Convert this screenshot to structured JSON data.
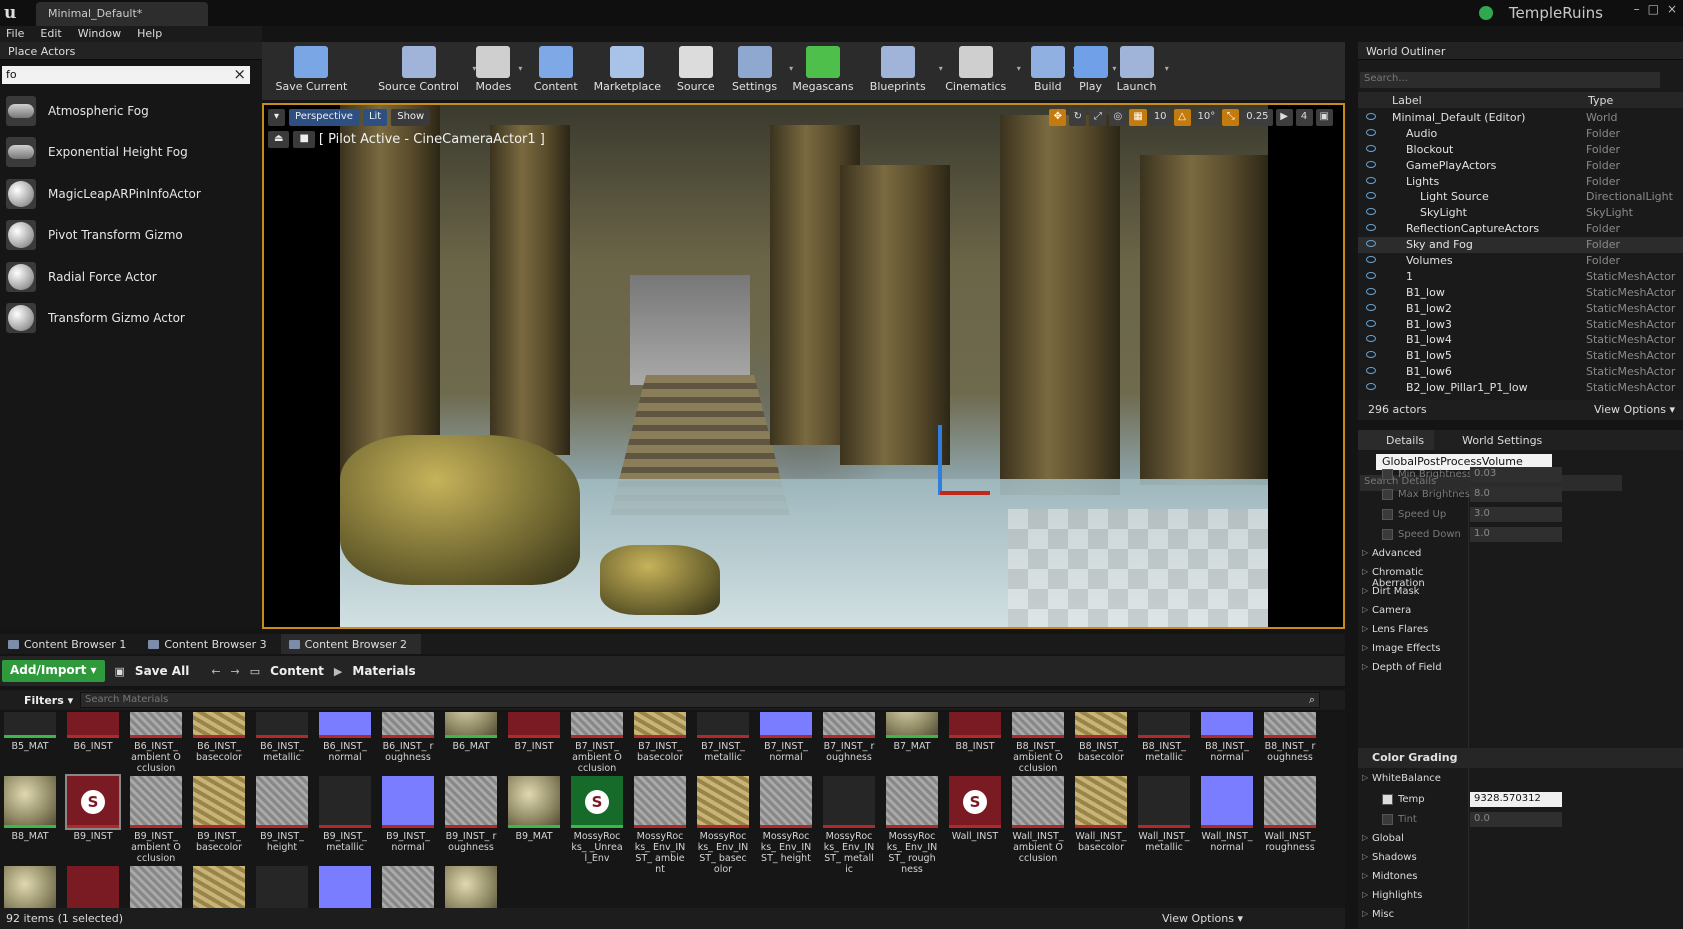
{
  "window": {
    "doc_tab": "Minimal_Default*",
    "project": "TempleRuins",
    "controls": [
      "–",
      "□",
      "×"
    ]
  },
  "menu": [
    "File",
    "Edit",
    "Window",
    "Help"
  ],
  "place_actors": {
    "tab": "Place Actors",
    "search_value": "fo",
    "items": [
      {
        "label": "Atmospheric Fog",
        "icon": "cloud-icon"
      },
      {
        "label": "Exponential Height Fog",
        "icon": "cloud-icon"
      },
      {
        "label": "MagicLeapARPinInfoActor",
        "icon": "sphere-icon"
      },
      {
        "label": "Pivot Transform Gizmo",
        "icon": "sphere-icon"
      },
      {
        "label": "Radial Force Actor",
        "icon": "radial-icon"
      },
      {
        "label": "Transform Gizmo Actor",
        "icon": "sphere-icon"
      }
    ]
  },
  "toolbar": {
    "buttons": [
      {
        "label": "Save Current",
        "icon": "save-icon",
        "color": "#7aa6e6"
      },
      {
        "label": "Source Control",
        "icon": "source-control-icon",
        "color": "#9fb4d8"
      },
      {
        "label": "Modes",
        "icon": "modes-icon",
        "color": "#cfcfcf"
      },
      {
        "label": "Content",
        "icon": "content-icon",
        "color": "#7ea9e6"
      },
      {
        "label": "Marketplace",
        "icon": "marketplace-icon",
        "color": "#a9c3e8"
      },
      {
        "label": "Source",
        "icon": "source-icon",
        "color": "#dcdcdc"
      },
      {
        "label": "Settings",
        "icon": "settings-icon",
        "color": "#8fa8d0"
      },
      {
        "label": "Megascans",
        "icon": "megascans-icon",
        "color": "#4fbf4b"
      },
      {
        "label": "Blueprints",
        "icon": "blueprints-icon",
        "color": "#9fb4d8"
      },
      {
        "label": "Cinematics",
        "icon": "cinematics-icon",
        "color": "#cfcfcf"
      },
      {
        "label": "Build",
        "icon": "build-icon",
        "color": "#8fb0e0"
      },
      {
        "label": "Play",
        "icon": "play-icon",
        "color": "#6fa0e8"
      },
      {
        "label": "Launch",
        "icon": "launch-icon",
        "color": "#9fb4d8"
      }
    ]
  },
  "viewport": {
    "perspective": "Perspective",
    "lit": "Lit",
    "show": "Show",
    "pilot": "[ Pilot Active - CineCameraActor1 ]",
    "grid": "10",
    "rotation": "10°",
    "scale": "0.25",
    "camera_speed": "4"
  },
  "content_browser": {
    "tabs": [
      "Content Browser 1",
      "Content Browser 3",
      "Content Browser 2"
    ],
    "add_import": "Add/Import ▾",
    "save_all": "Save All",
    "path": [
      "Content",
      "Materials"
    ],
    "filters": "Filters ▾",
    "search_placeholder": "Search Materials",
    "row1": [
      {
        "name": "B5_MAT",
        "tex": "t-dark",
        "kind": "mat"
      },
      {
        "name": "B6_INST",
        "tex": "t-red",
        "kind": "inst"
      },
      {
        "name": "B6_INST_ ambient Occlusion",
        "tex": "t-gray",
        "kind": "inst"
      },
      {
        "name": "B6_INST_ basecolor",
        "tex": "t-gold",
        "kind": "inst"
      },
      {
        "name": "B6_INST_ metallic",
        "tex": "t-dark",
        "kind": "inst"
      },
      {
        "name": "B6_INST_ normal",
        "tex": "t-blue",
        "kind": "inst"
      },
      {
        "name": "B6_INST_ roughness",
        "tex": "t-gray",
        "kind": "inst"
      },
      {
        "name": "B6_MAT",
        "tex": "t-rock",
        "kind": "mat"
      },
      {
        "name": "B7_INST",
        "tex": "t-red",
        "kind": "inst"
      },
      {
        "name": "B7_INST_ ambient Occlusion",
        "tex": "t-gray",
        "kind": "inst"
      },
      {
        "name": "B7_INST_ basecolor",
        "tex": "t-gold",
        "kind": "inst"
      },
      {
        "name": "B7_INST_ metallic",
        "tex": "t-dark",
        "kind": "inst"
      },
      {
        "name": "B7_INST_ normal",
        "tex": "t-blue",
        "kind": "inst"
      },
      {
        "name": "B7_INST_ roughness",
        "tex": "t-gray",
        "kind": "inst"
      },
      {
        "name": "B7_MAT",
        "tex": "t-rock",
        "kind": "mat"
      },
      {
        "name": "B8_INST",
        "tex": "t-red",
        "kind": "inst"
      },
      {
        "name": "B8_INST_ ambient Occlusion",
        "tex": "t-gray",
        "kind": "inst"
      },
      {
        "name": "B8_INST_ basecolor",
        "tex": "t-gold",
        "kind": "inst"
      },
      {
        "name": "B8_INST_ metallic",
        "tex": "t-dark",
        "kind": "inst"
      },
      {
        "name": "B8_INST_ normal",
        "tex": "t-blue",
        "kind": "inst"
      },
      {
        "name": "B8_INST_ roughness",
        "tex": "t-gray",
        "kind": "inst"
      }
    ],
    "row2": [
      {
        "name": "B8_MAT",
        "tex": "t-rock",
        "kind": "mat",
        "logo": ""
      },
      {
        "name": "B9_INST",
        "tex": "t-red",
        "kind": "inst",
        "logo": "S",
        "selected": true
      },
      {
        "name": "B9_INST_ ambient Occlusion",
        "tex": "t-gray",
        "kind": "inst",
        "logo": ""
      },
      {
        "name": "B9_INST_ basecolor",
        "tex": "t-gold",
        "kind": "inst",
        "logo": ""
      },
      {
        "name": "B9_INST_ height",
        "tex": "t-gray",
        "kind": "inst",
        "logo": ""
      },
      {
        "name": "B9_INST_ metallic",
        "tex": "t-dark",
        "kind": "inst",
        "logo": ""
      },
      {
        "name": "B9_INST_ normal",
        "tex": "t-blue",
        "kind": "inst",
        "logo": ""
      },
      {
        "name": "B9_INST_ roughness",
        "tex": "t-gray",
        "kind": "inst",
        "logo": ""
      },
      {
        "name": "B9_MAT",
        "tex": "t-rock",
        "kind": "mat",
        "logo": ""
      },
      {
        "name": "MossyRocks_ _Unreal_Env",
        "tex": "t-green",
        "kind": "mat",
        "logo": "S"
      },
      {
        "name": "MossyRocks_ Env_INST_ ambient",
        "tex": "t-gray",
        "kind": "inst",
        "logo": ""
      },
      {
        "name": "MossyRocks_ Env_INST_ basecolor",
        "tex": "t-gold",
        "kind": "inst",
        "logo": ""
      },
      {
        "name": "MossyRocks_ Env_INST_ height",
        "tex": "t-gray",
        "kind": "inst",
        "logo": ""
      },
      {
        "name": "MossyRocks_ Env_INST_ metallic",
        "tex": "t-dark",
        "kind": "inst",
        "logo": ""
      },
      {
        "name": "MossyRocks_ Env_INST_ roughness",
        "tex": "t-gray",
        "kind": "inst",
        "logo": ""
      },
      {
        "name": "Wall_INST",
        "tex": "t-red",
        "kind": "inst",
        "logo": "S"
      },
      {
        "name": "Wall_INST_ ambient Occlusion",
        "tex": "t-gray",
        "kind": "inst",
        "logo": ""
      },
      {
        "name": "Wall_INST_ basecolor",
        "tex": "t-gold",
        "kind": "inst",
        "logo": ""
      },
      {
        "name": "Wall_INST_ metallic",
        "tex": "t-dark",
        "kind": "inst",
        "logo": ""
      },
      {
        "name": "Wall_INST_ normal",
        "tex": "t-blue",
        "kind": "inst",
        "logo": ""
      },
      {
        "name": "Wall_INST_ roughness",
        "tex": "t-gray",
        "kind": "inst",
        "logo": ""
      }
    ],
    "status": "92 items (1 selected)",
    "view_options": "View Options ▾"
  },
  "outliner": {
    "tab": "World Outliner",
    "search_placeholder": "Search...",
    "col_label": "Label",
    "col_type": "Type",
    "rows": [
      {
        "label": "Minimal_Default (Editor)",
        "type": "World",
        "indent": 0
      },
      {
        "label": "Audio",
        "type": "Folder",
        "indent": 1
      },
      {
        "label": "Blockout",
        "type": "Folder",
        "indent": 1
      },
      {
        "label": "GamePlayActors",
        "type": "Folder",
        "indent": 1
      },
      {
        "label": "Lights",
        "type": "Folder",
        "indent": 1
      },
      {
        "label": "Light Source",
        "type": "DirectionalLight",
        "indent": 2
      },
      {
        "label": "SkyLight",
        "type": "SkyLight",
        "indent": 2
      },
      {
        "label": "ReflectionCaptureActors",
        "type": "Folder",
        "indent": 1
      },
      {
        "label": "Sky and Fog",
        "type": "Folder",
        "indent": 1,
        "hl": true
      },
      {
        "label": "Volumes",
        "type": "Folder",
        "indent": 1
      },
      {
        "label": "1",
        "type": "StaticMeshActor",
        "indent": 1
      },
      {
        "label": "B1_low",
        "type": "StaticMeshActor",
        "indent": 1
      },
      {
        "label": "B1_low2",
        "type": "StaticMeshActor",
        "indent": 1
      },
      {
        "label": "B1_low3",
        "type": "StaticMeshActor",
        "indent": 1
      },
      {
        "label": "B1_low4",
        "type": "StaticMeshActor",
        "indent": 1
      },
      {
        "label": "B1_low5",
        "type": "StaticMeshActor",
        "indent": 1
      },
      {
        "label": "B1_low6",
        "type": "StaticMeshActor",
        "indent": 1
      },
      {
        "label": "B2_low_Pillar1_P1_low",
        "type": "StaticMeshActor",
        "indent": 1
      }
    ],
    "count": "296 actors",
    "view_options": "View Options ▾"
  },
  "details": {
    "tabs": [
      "Details",
      "World Settings"
    ],
    "actor_name": "GlobalPostProcessVolume",
    "search_placeholder": "Search Details",
    "exposure": [
      {
        "label": "Min Brightness",
        "value": "0.03"
      },
      {
        "label": "Max Brightness",
        "value": "8.0"
      },
      {
        "label": "Speed Up",
        "value": "3.0"
      },
      {
        "label": "Speed Down",
        "value": "1.0"
      }
    ],
    "advanced": "Advanced",
    "sections": [
      "Chromatic Aberration",
      "Dirt Mask",
      "Camera",
      "Lens Flares",
      "Image Effects",
      "Depth of Field"
    ],
    "color_grading": "Color Grading",
    "white_balance": "WhiteBalance",
    "temp_label": "Temp",
    "temp_value": "9328.570312",
    "tint_label": "Tint",
    "tint_value": "0.0",
    "cg_sections": [
      "Global",
      "Shadows",
      "Midtones",
      "Highlights",
      "Misc"
    ]
  }
}
